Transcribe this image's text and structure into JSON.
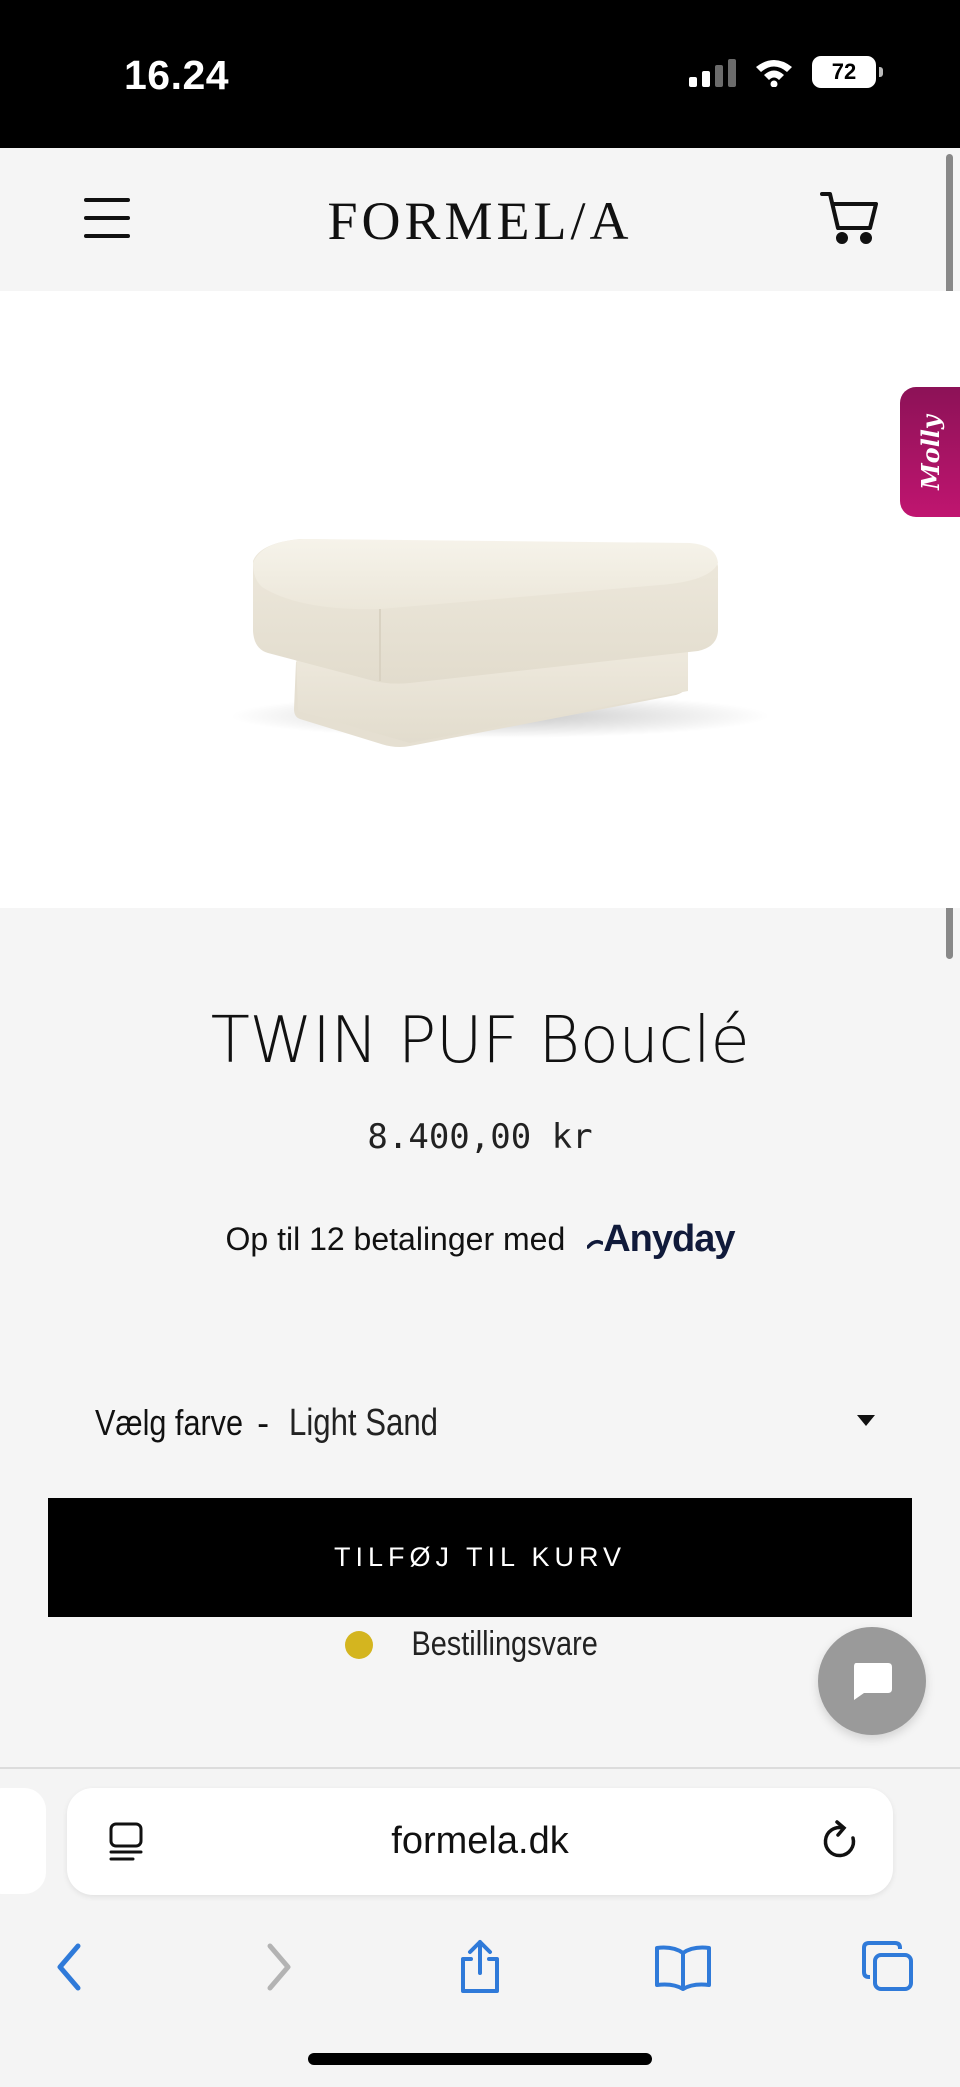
{
  "status_bar": {
    "time": "16.24",
    "battery": "72"
  },
  "header": {
    "logo": "FORMEL/A"
  },
  "molly_tab": {
    "label": "Molly"
  },
  "product": {
    "title": "TWIN PUF Bouclé",
    "price": "8.400,00 kr",
    "payment_text": "Op til 12 betalinger med",
    "payment_provider": "Anyday",
    "color_label": "Vælg farve",
    "color_separator": "-",
    "color_value": "Light Sand",
    "add_to_cart": "TILFØJ TIL KURV",
    "stock_status": "Bestillingsvare",
    "stock_color": "#d4b51f"
  },
  "browser": {
    "url": "formela.dk"
  },
  "colors": {
    "accent_blue": "#2f7ad9",
    "molly_pink": "#b0156a"
  }
}
